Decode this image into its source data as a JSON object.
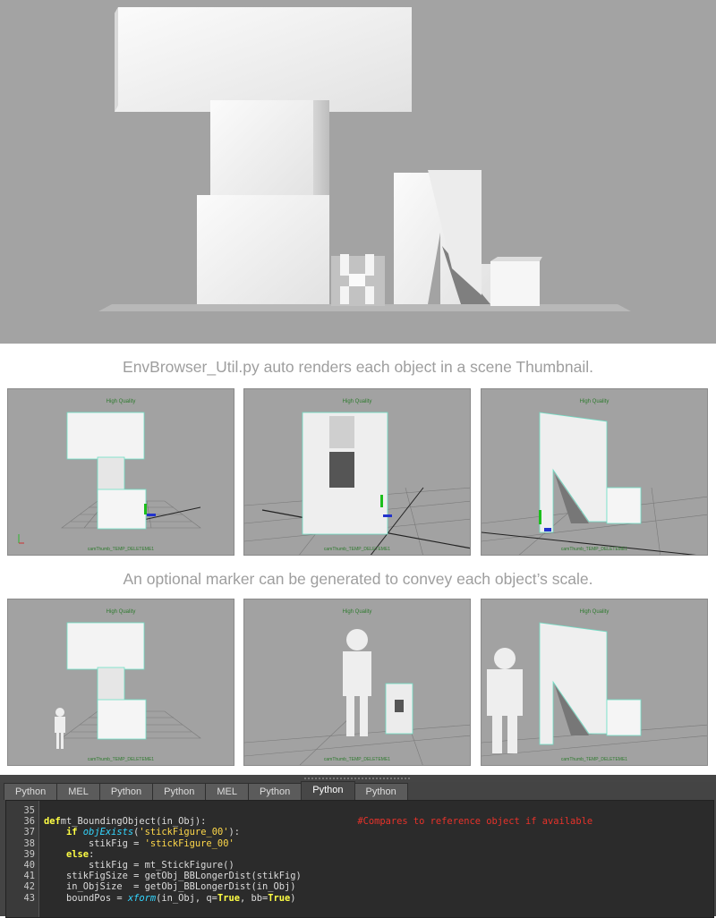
{
  "caption_top": "EnvBrowser_Util.py auto renders each object in a scene Thumbnail.",
  "caption_middle": "An optional marker can be generated to convey each object’s scale.",
  "viewport": {
    "quality_label": "High Quality",
    "camera_label": "camThumb_TEMP_DELETEME1"
  },
  "editor": {
    "tabs": [
      {
        "label": "Python",
        "active": false
      },
      {
        "label": "MEL",
        "active": false
      },
      {
        "label": "Python",
        "active": false
      },
      {
        "label": "Python",
        "active": false
      },
      {
        "label": "MEL",
        "active": false
      },
      {
        "label": "Python",
        "active": false
      },
      {
        "label": "Python",
        "active": true
      },
      {
        "label": "Python",
        "active": false
      }
    ],
    "lines": [
      {
        "n": "35",
        "parts": []
      },
      {
        "n": "36",
        "parts": [
          [
            "kw",
            "def"
          ],
          [
            "",
            "mt_BoundingObject(in_Obj):"
          ],
          [
            "",
            "                           "
          ],
          [
            "cm",
            "#Compares to reference object if available"
          ]
        ]
      },
      {
        "n": "37",
        "parts": [
          [
            "",
            "    "
          ],
          [
            "kw",
            "if"
          ],
          [
            "",
            ""
          ],
          [
            "",
            ""
          ],
          [
            "",
            ""
          ],
          [
            "",
            ""
          ],
          [
            "fn",
            " objExists"
          ],
          [
            "",
            "("
          ],
          [
            "st",
            "'stickFigure_00'"
          ],
          [
            "",
            "):"
          ]
        ]
      },
      {
        "n": "38",
        "parts": [
          [
            "",
            "        stikFig = "
          ],
          [
            "st",
            "'stickFigure_00'"
          ]
        ]
      },
      {
        "n": "39",
        "parts": [
          [
            "",
            "    "
          ],
          [
            "kw",
            "else"
          ],
          [
            "",
            ":"
          ]
        ]
      },
      {
        "n": "40",
        "parts": [
          [
            "",
            "        stikFig = mt_StickFigure()"
          ]
        ]
      },
      {
        "n": "41",
        "parts": [
          [
            "",
            "    stikFigSize = getObj_BBLongerDist(stikFig)"
          ]
        ]
      },
      {
        "n": "42",
        "parts": [
          [
            "",
            "    in_ObjSize  = getObj_BBLongerDist(in_Obj)"
          ]
        ]
      },
      {
        "n": "43",
        "parts": [
          [
            "",
            "    boundPos = "
          ],
          [
            "fn",
            "xform"
          ],
          [
            "",
            "(in_Obj, q="
          ],
          [
            "bt",
            "True"
          ],
          [
            "",
            ", bb="
          ],
          [
            "bt",
            "True"
          ],
          [
            "",
            ")"
          ]
        ]
      }
    ]
  }
}
